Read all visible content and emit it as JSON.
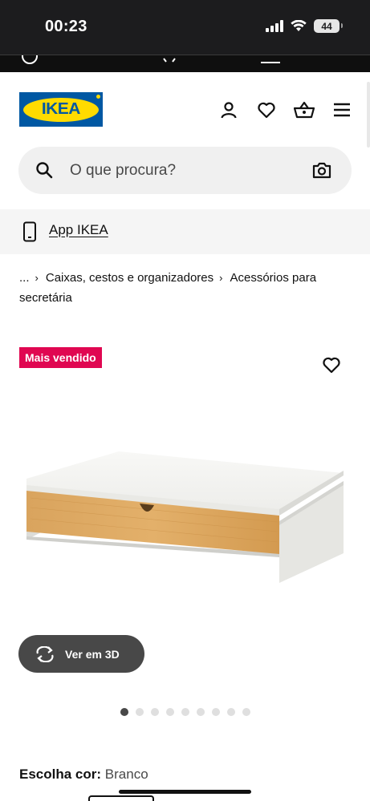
{
  "status_bar": {
    "time": "00:23",
    "battery": "44",
    "icons": [
      "signal-icon",
      "wifi-icon",
      "battery-icon"
    ]
  },
  "header": {
    "logo_text": "IKEA",
    "icons": [
      "user-icon",
      "heart-icon",
      "basket-icon",
      "menu-icon"
    ]
  },
  "search": {
    "placeholder": "O que procura?",
    "icons": [
      "search-icon",
      "camera-icon"
    ]
  },
  "app_banner": {
    "label": "App IKEA",
    "icon": "smartphone-icon"
  },
  "breadcrumb": {
    "ellipsis": "...",
    "items": [
      "Caixas, cestos e organizadores",
      "Acessórios para secretária"
    ]
  },
  "product": {
    "badge": "Mais vendido",
    "view_3d_label": "Ver em 3D",
    "carousel": {
      "total": 9,
      "active_index": 0
    },
    "color_label": "Escolha cor:",
    "color_value": "Branco"
  },
  "colors": {
    "ikea_blue": "#0058a3",
    "ikea_yellow": "#ffdb00",
    "badge_pink": "#e00751",
    "button_dark": "#484848"
  }
}
